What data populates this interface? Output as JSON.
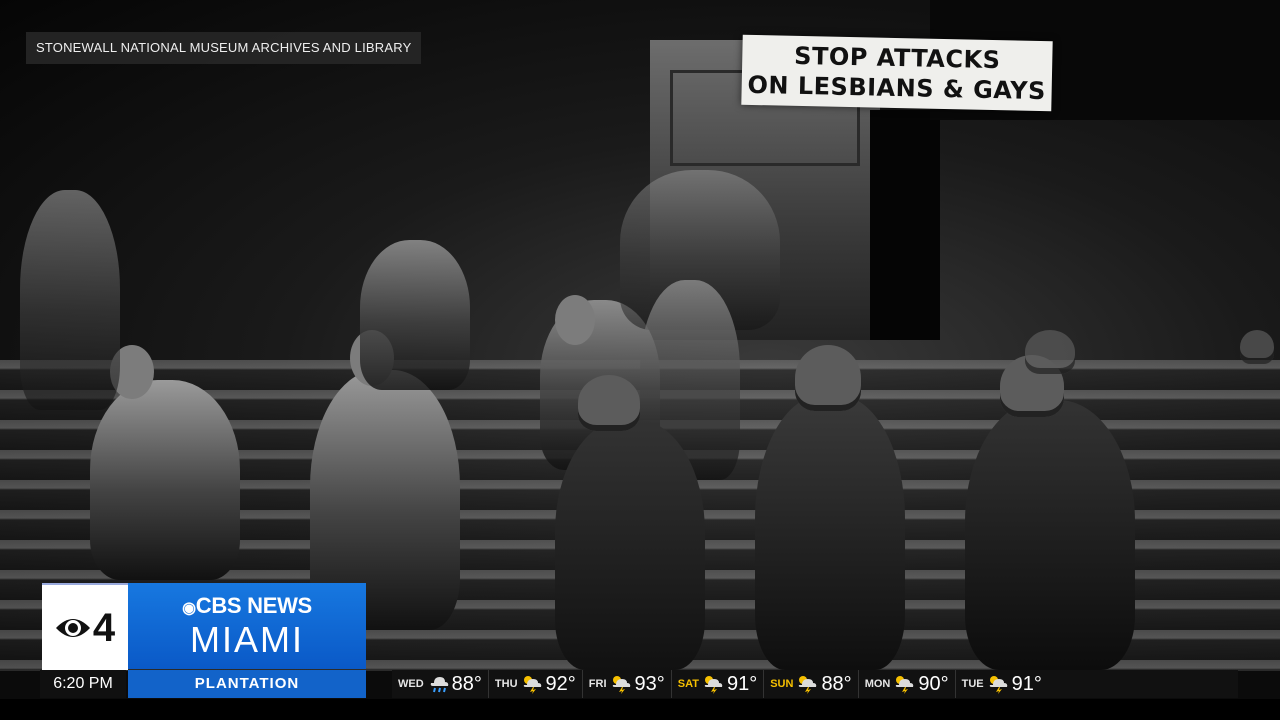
{
  "credit": "STONEWALL NATIONAL MUSEUM ARCHIVES AND LIBRARY",
  "banner": {
    "line1": "STOP ATTACKS",
    "line2": "ON LESBIANS & GAYS"
  },
  "logo": {
    "channel_number": "4",
    "brand": "CBS NEWS",
    "city": "MIAMI",
    "brand_color": "#1778e0"
  },
  "ticker": {
    "time": "6:20 PM",
    "location": "PLANTATION",
    "location_color": "#1263c9"
  },
  "forecast": [
    {
      "day": "WED",
      "icon": "rain-icon",
      "temp": "88°"
    },
    {
      "day": "THU",
      "icon": "thunderstorm-icon",
      "temp": "92°"
    },
    {
      "day": "FRI",
      "icon": "thunderstorm-icon",
      "temp": "93°"
    },
    {
      "day": "SAT",
      "icon": "thunderstorm-icon",
      "temp": "91°"
    },
    {
      "day": "SUN",
      "icon": "thunderstorm-icon",
      "temp": "88°"
    },
    {
      "day": "MON",
      "icon": "thunderstorm-icon",
      "temp": "90°"
    },
    {
      "day": "TUE",
      "icon": "thunderstorm-icon",
      "temp": "91°"
    }
  ]
}
